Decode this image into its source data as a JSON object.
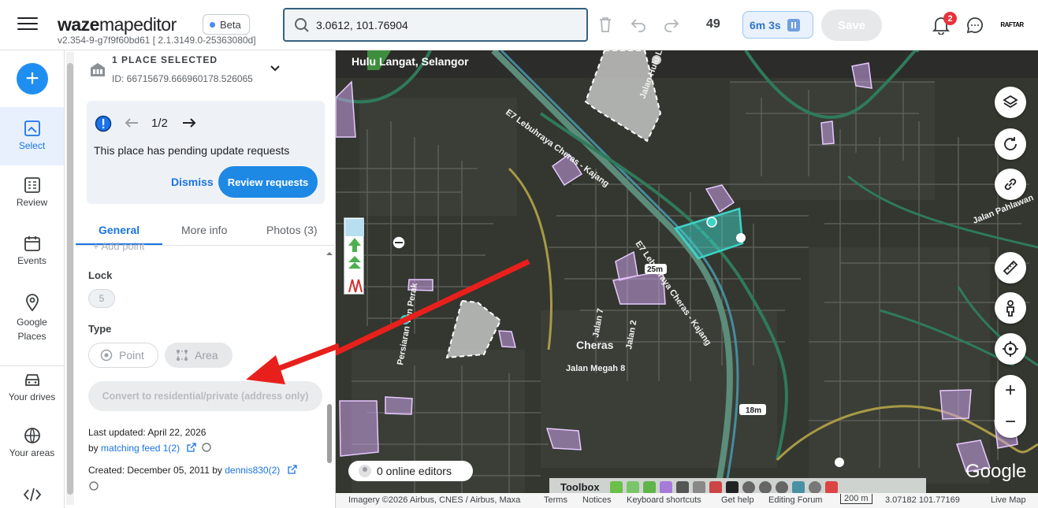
{
  "app": {
    "logo_bold": "waze",
    "logo_rest": "mapeditor",
    "beta_label": "Beta",
    "version": "v2.354-9-g7f9f60bd61 [ 2.1.3149.0-25363080d]"
  },
  "header": {
    "search_value": "3.0612, 101.76904",
    "edit_count": "49",
    "timer": "6m 3s",
    "save_label": "Save",
    "notification_count": "2",
    "avatar_text": "RAFTAR"
  },
  "nav": {
    "items": [
      {
        "label": "Select",
        "icon": "select-icon",
        "active": true
      },
      {
        "label": "Review",
        "icon": "review-icon"
      },
      {
        "label": "Events",
        "icon": "events-icon"
      },
      {
        "label": "Google Places",
        "icon": "google-places-icon"
      },
      {
        "label": "Your drives",
        "icon": "car-icon"
      },
      {
        "label": "Your areas",
        "icon": "globe-icon"
      },
      {
        "label": "",
        "icon": "code-icon"
      }
    ]
  },
  "panel": {
    "title": "1 PLACE SELECTED",
    "id_text": "ID: 66715679.666960178.526065",
    "pending": {
      "pager": "1/2",
      "message": "This place has pending update requests",
      "dismiss_label": "Dismiss",
      "review_label": "Review requests"
    },
    "tabs": [
      "General",
      "More info",
      "Photos (3)"
    ],
    "add_point": "+ Add point",
    "lock_label": "Lock",
    "lock_value": "5",
    "type_label": "Type",
    "type_point": "Point",
    "type_area": "Area",
    "convert_label": "Convert to residential/private (address only)",
    "last_updated": "Last updated: April 22, 2026",
    "by_prefix": "by",
    "updated_by": "matching feed 1(2)",
    "created": "Created: December 05, 2011 by",
    "created_by": "dennis830(2)"
  },
  "map": {
    "location_title": "Hulu Langat, Selangor",
    "online_editors": "0 online editors",
    "toolbox_label": "Toolbox",
    "google_logo": "Google",
    "labels": {
      "lebuhraya1": "E7 Lebuhraya Cheras - Kajang",
      "lebuhraya2": "E7 Lebuhraya Cheras - Kajang",
      "jalan_hulu_langat": "Jalan Hulu Langat",
      "jalan_pahlawan": "Jalan Pahlawan",
      "jalan_megah": "Jalan Megah 8",
      "jalan_2": "Jalan 2",
      "jalan_7": "Jalan 7",
      "cheras": "Cheras",
      "persiaran": "Persiaran Tun Perak",
      "dist25": "25m",
      "dist18": "18m"
    },
    "footer": {
      "imagery": "Imagery ©2026 Airbus, CNES / Airbus, Maxa",
      "terms": "Terms",
      "notices": "Notices",
      "shortcuts": "Keyboard shortcuts",
      "help": "Get help",
      "forum": "Editing Forum",
      "scale": "200 m",
      "coords": "3.07182 101.77169",
      "live_map": "Live Map"
    }
  },
  "colors": {
    "accent": "#1a73e8",
    "selected_area": "#3fd3c8",
    "place_area": "#c9a0e8",
    "highway": "#2f8a6a",
    "arrow": "#e8201c"
  }
}
